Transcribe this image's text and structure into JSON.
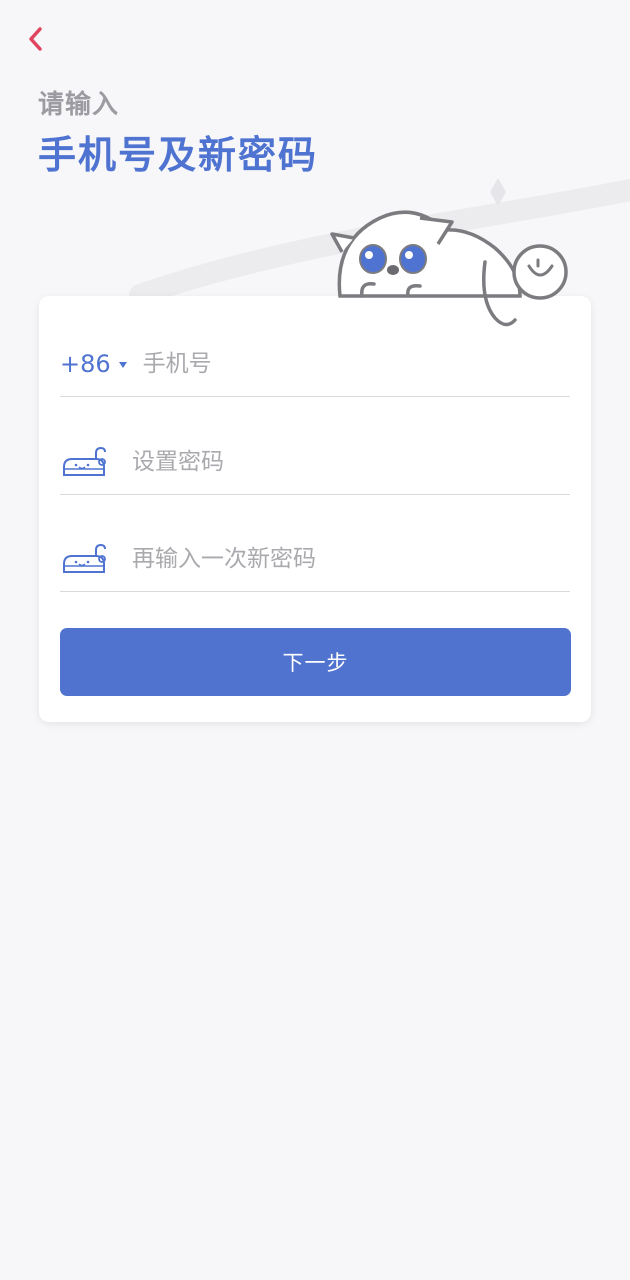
{
  "header": {
    "subtitle": "请输入",
    "title": "手机号及新密码"
  },
  "form": {
    "country_code": "+86",
    "phone_placeholder": "手机号",
    "password_placeholder": "设置密码",
    "confirm_password_placeholder": "再输入一次新密码",
    "next_label": "下一步"
  },
  "colors": {
    "accent": "#4f73d0",
    "back_arrow": "#e0455f",
    "background": "#f7f7f9"
  }
}
